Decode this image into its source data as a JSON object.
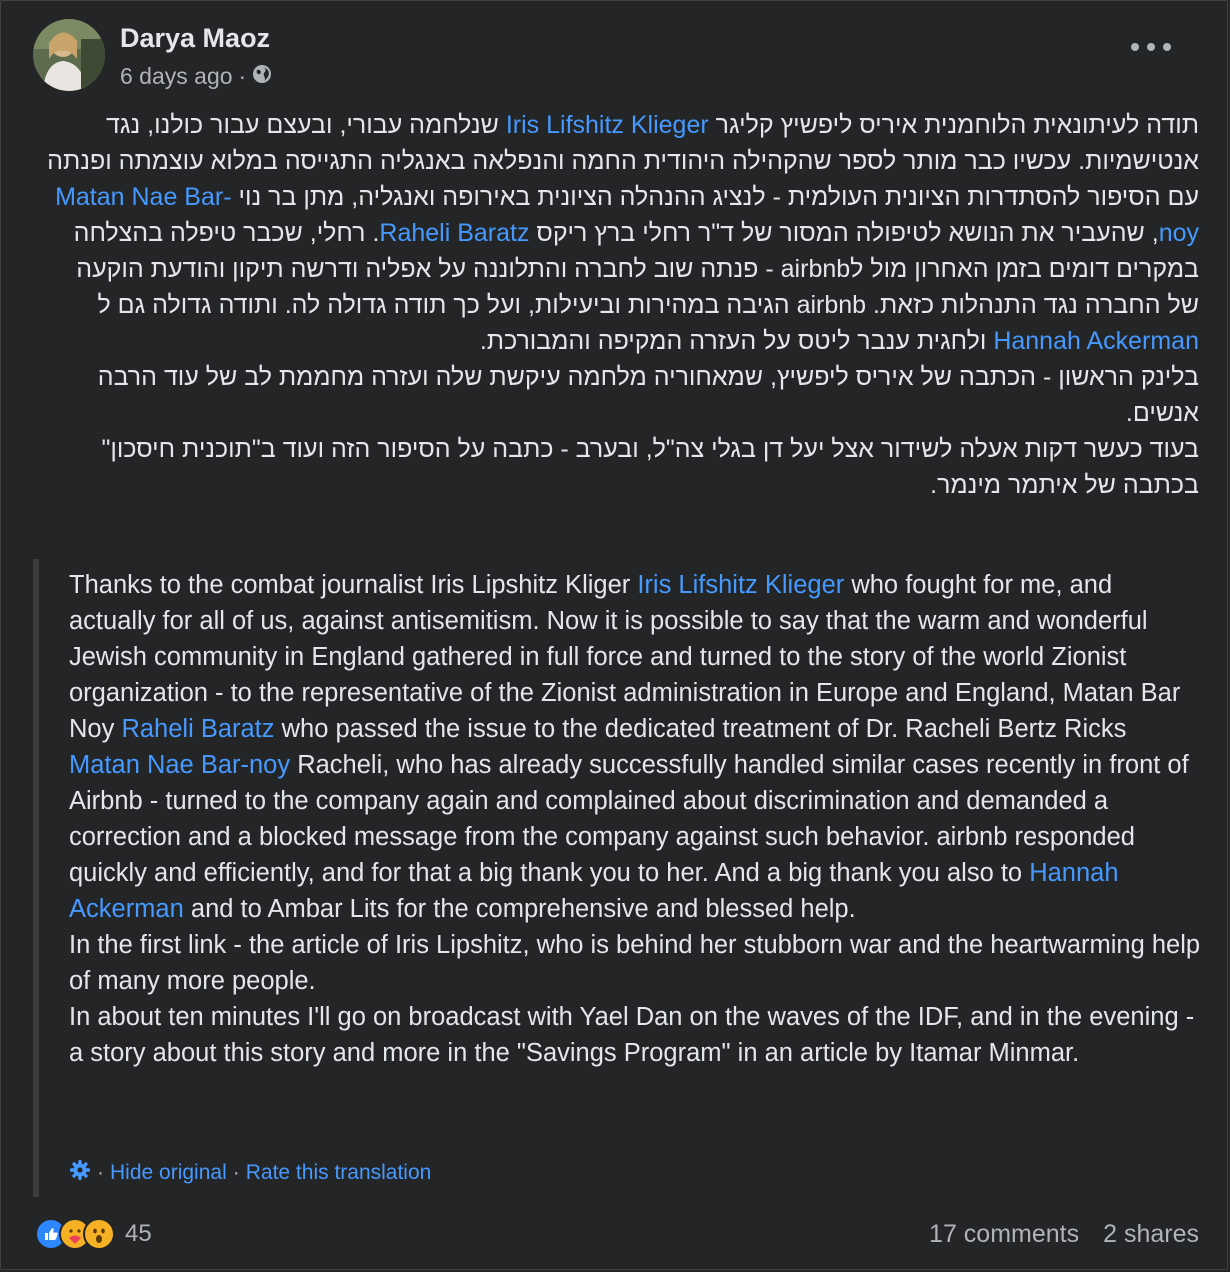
{
  "post": {
    "author": "Darya Maoz",
    "time": "6 days ago",
    "audience_icon": "globe-icon",
    "menu_icon": "more-horizontal-icon"
  },
  "hebrew": {
    "p1_a": "תודה לעיתונאית הלוחמנית איריס ליפשיץ קליגר",
    "p1_link1": "Iris Lifshitz Klieger",
    "p1_b": "שנלחמה עבורי, ובעצם עבור כולנו, נגד אנטישמיות. עכשיו כבר מותר לספר שהקהילה היהודית החמה והנפלאה באנגליה התגייסה במלוא עוצמתה ופנתה עם הסיפור להסתדרות הציונית העולמית - לנציג ההנהלה הציונית באירופה ואנגליה, מתן בר נוי",
    "p1_link2": "Matan Nae Bar-noy",
    "p1_c": ", שהעביר את הנושא לטיפולה המסור של ד\"ר רחלי ברץ ריקס",
    "p1_link3": "Raheli Baratz",
    "p1_d": ". רחלי, שכבר טיפלה בהצלחה במקרים דומים בזמן האחרון מול לairbnb  - פנתה שוב לחברה והתלוננה על אפליה ודרשה תיקון והודעת הוקעה של החברה נגד התנהלות כזאת. airbnb הגיבה במהירות וביעילות, ועל כך תודה גדולה לה. ותודה גדולה גם ל",
    "p1_link4": "Hannah Ackerman",
    "p1_e": " ולחגית ענבר ליטס על העזרה המקיפה והמבורכת.",
    "p2": "בלינק הראשון - הכתבה של איריס ליפשיץ, שמאחוריה מלחמה עיקשת שלה ועזרה מחממת לב של עוד הרבה אנשים.",
    "p3": "בעוד כעשר דקות אעלה לשידור אצל יעל דן בגלי צה\"ל, ובערב - כתבה על הסיפור הזה ועוד ב\"תוכנית חיסכון\" בכתבה של איתמר מינמר."
  },
  "translation": {
    "p1_a": "Thanks to the combat journalist Iris Lipshitz Kliger ",
    "p1_link1": "Iris Lifshitz Klieger",
    "p1_b": " who fought for me, and actually for all of us, against antisemitism. Now it is possible to say that the warm and wonderful Jewish community in England gathered in full force and turned to the story of the world Zionist organization - to the representative of the Zionist administration in Europe and England, Matan Bar Noy ",
    "p1_link2": "Raheli Baratz",
    "p1_c": " who passed the issue to the dedicated treatment of Dr. Racheli Bertz Ricks ",
    "p1_link3": "Matan Nae Bar-noy",
    "p1_d": " Racheli, who has already successfully handled similar cases recently in front of Airbnb - turned to the company again and complained about discrimination and demanded a correction and a blocked message from the company against such behavior. airbnb responded quickly and efficiently, and for that a big thank you to her. And a big thank you also to ",
    "p1_link4": "Hannah Ackerman",
    "p1_e": " and to Ambar Lits for the comprehensive and blessed help.",
    "p2": "In the first link - the article of Iris Lipshitz, who is behind her stubborn war and the heartwarming help of many more people.",
    "p3": "In about ten minutes I'll go on broadcast with Yael Dan on the waves of the IDF, and in the evening - a story about this story and more in the \"Savings Program\" in an article by Itamar Minmar.",
    "hide_original": "Hide original",
    "rate": "Rate this translation",
    "separator": "·",
    "settings_icon": "gear-icon"
  },
  "footer": {
    "reaction_icons": [
      "like-icon",
      "care-icon",
      "wow-icon"
    ],
    "reaction_count": "45",
    "comments": "17 comments",
    "shares": "2 shares"
  },
  "colors": {
    "background": "#242526",
    "text": "#e4e6eb",
    "secondary": "#b0b3b8",
    "link": "#4599ff"
  }
}
